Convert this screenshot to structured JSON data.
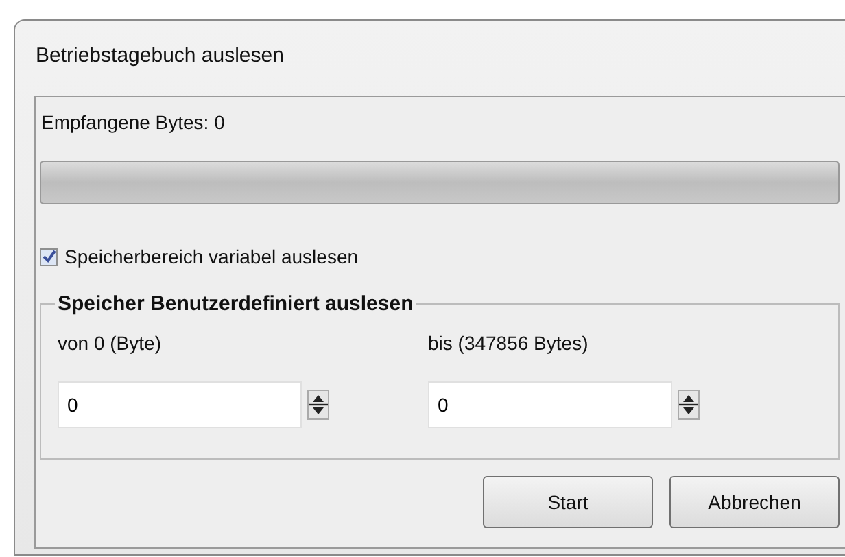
{
  "window": {
    "title": "Betriebstagebuch auslesen"
  },
  "received_label": "Empfangene Bytes: 0",
  "progress": {
    "level": 0
  },
  "variable_range": {
    "label": "Speicherbereich variabel auslesen",
    "checked": true
  },
  "custom_range": {
    "title": "Speicher Benutzerdefiniert auslesen",
    "fields": [
      {
        "label": "von 0 (Byte)",
        "value": "0"
      },
      {
        "label": "bis (347856 Bytes)",
        "value": "0"
      }
    ]
  },
  "buttons": [
    "Start",
    "Abbrechen"
  ]
}
